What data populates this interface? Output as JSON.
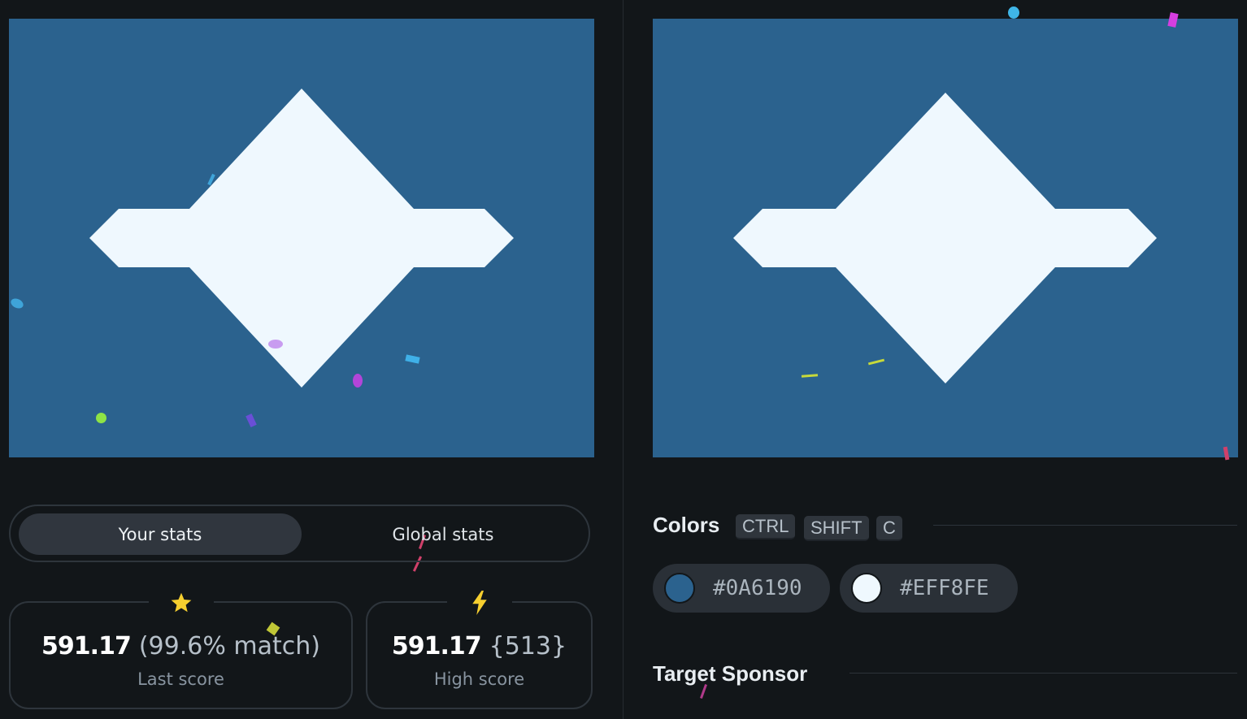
{
  "canvas": {
    "background": "#2B628E",
    "shape_color": "#EFF8FE"
  },
  "tabs": {
    "your_stats": "Your stats",
    "global_stats": "Global stats"
  },
  "stats": {
    "last": {
      "icon": "star-icon",
      "score": "591.17",
      "extra": "(99.6% match)",
      "label": "Last score"
    },
    "high": {
      "icon": "lightning-icon",
      "score": "591.17",
      "extra": "{513}",
      "label": "High score"
    }
  },
  "colors_section": {
    "title": "Colors",
    "shortcut": [
      "CTRL",
      "SHIFT",
      "C"
    ],
    "swatches": [
      {
        "hex": "#0A6190",
        "color": "#2B628E"
      },
      {
        "hex": "#EFF8FE",
        "color": "#EFF8FE"
      }
    ]
  },
  "sponsor_section": {
    "title": "Target Sponsor"
  }
}
